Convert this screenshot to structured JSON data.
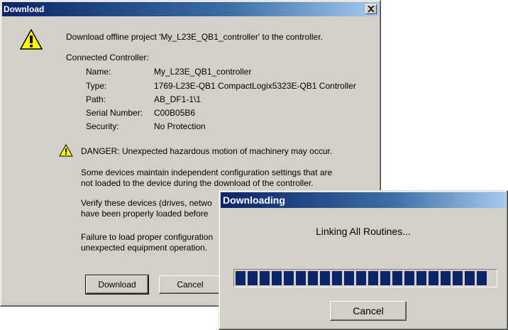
{
  "download_dialog": {
    "title": "Download",
    "close_glyph": "✕",
    "message": "Download offline project 'My_L23E_QB1_controller' to the controller.",
    "connected_label": "Connected Controller:",
    "fields": [
      {
        "label": "Name:",
        "value": "My_L23E_QB1_controller"
      },
      {
        "label": "Type:",
        "value": "1769-L23E-QB1 CompactLogix5323E-QB1 Controller"
      },
      {
        "label": "Path:",
        "value": "AB_DF1-1\\1"
      },
      {
        "label": "Serial Number:",
        "value": "C00B05B6"
      },
      {
        "label": "Security:",
        "value": "No Protection"
      }
    ],
    "danger": "DANGER: Unexpected hazardous motion of machinery may occur.",
    "para1_line1": "Some devices maintain independent configuration settings that are",
    "para1_line2": "not loaded to the device during the download of the controller.",
    "para2_line1": "Verify these devices (drives, netwo",
    "para2_line2": "have been properly loaded before",
    "para3_line1": "Failure to load proper configuration",
    "para3_line2": "unexpected equipment operation.",
    "download_button": "Download",
    "cancel_button": "Cancel",
    "warning_icon": "warning-icon",
    "close_icon": "close-icon"
  },
  "downloading_dialog": {
    "title": "Downloading",
    "status": "Linking All Routines...",
    "progress_fraction": 1.0,
    "cancel_button": "Cancel"
  }
}
